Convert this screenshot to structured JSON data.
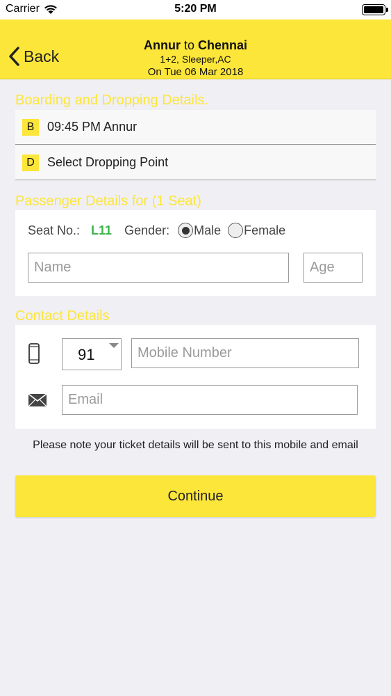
{
  "status_bar": {
    "carrier": "Carrier",
    "time": "5:20 PM"
  },
  "nav": {
    "back_label": "Back",
    "origin": "Annur",
    "to_word": "to",
    "destination": "Chennai",
    "bus_type": "1+2, Sleeper,AC",
    "date": "On Tue 06 Mar 2018"
  },
  "boarding": {
    "section_title": "Boarding and Dropping Details.",
    "boarding_badge": "B",
    "boarding_value": "09:45 PM Annur",
    "dropping_badge": "D",
    "dropping_value": "Select Dropping Point"
  },
  "passenger": {
    "section_title": "Passenger Details for (1 Seat)",
    "seat_label": "Seat No.:",
    "seat_value": "L11",
    "gender_label": "Gender:",
    "gender_options": [
      "Male",
      "Female"
    ],
    "gender_selected": "Male",
    "name_placeholder": "Name",
    "age_placeholder": "Age"
  },
  "contact": {
    "section_title": "Contact Details",
    "country_code": "91",
    "mobile_placeholder": "Mobile Number",
    "email_placeholder": "Email"
  },
  "note": "Please note your ticket details will be sent to this mobile and email",
  "continue_label": "Continue",
  "colors": {
    "accent": "#fde63a",
    "seat_green": "#3bb54a",
    "background": "#efeff4"
  },
  "icons": [
    "wifi-icon",
    "battery-icon",
    "back-chevron-icon",
    "phone-icon",
    "mail-icon",
    "dropdown-caret-icon"
  ]
}
